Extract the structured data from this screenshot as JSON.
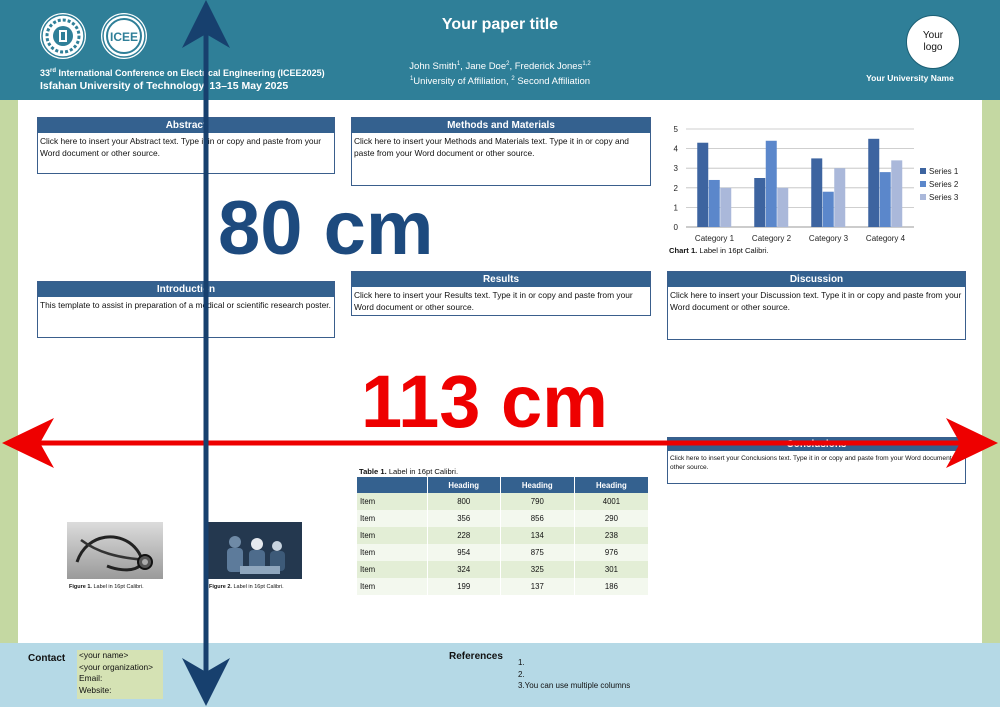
{
  "header": {
    "title": "Your paper title",
    "authors": [
      "John Smith",
      "Jane Doe",
      "Frederick Jones"
    ],
    "author_sups": [
      "1",
      "2",
      "1,2"
    ],
    "affiliation_1_sup": "1",
    "affiliation_1": "University of Affiliation, ",
    "affiliation_2_sup": "2",
    "affiliation_2": " Second Affiliation",
    "conference_line_prefix": "33",
    "conference_line_sup": "rd",
    "conference_line_rest": " International Conference on Electrical Engineering (ICEE2025)",
    "venue_line": "Isfahan University of Technology, 13–15 May 2025",
    "logo_placeholder": "Your logo",
    "university_name": "Your University Name"
  },
  "sections": {
    "abstract": {
      "title": "Abstract",
      "body": "Click here to insert your Abstract text. Type it in or copy and paste from your Word document or other source."
    },
    "methods": {
      "title": "Methods and Materials",
      "body": "Click here to insert your Methods and Materials text. Type it in or copy and paste from your Word document or other source."
    },
    "introduction": {
      "title": "Introduction",
      "body": "This template to assist in preparation of a medical or scientific research poster."
    },
    "results": {
      "title": "Results",
      "body": "Click here to insert your Results text. Type it in or copy and paste from your Word document or other source."
    },
    "discussion": {
      "title": "Discussion",
      "body": "Click here to insert your Discussion text. Type it in or copy and paste from your Word document or other source."
    },
    "conclusions": {
      "title": "Conclusions",
      "body": "Click here to insert your Conclusions text. Type it in or copy and paste from your Word document or other source."
    }
  },
  "chart_caption": {
    "label": "Chart 1.",
    "text": " Label in 16pt Calibri."
  },
  "table_caption": {
    "label": "Table 1.",
    "text": " Label in 16pt Calibri."
  },
  "figure_1_caption": {
    "label": "Figure 1.",
    "text": " Label in 16pt Calibri."
  },
  "figure_2_caption": {
    "label": "Figure 2.",
    "text": " Label in 16pt Calibri."
  },
  "table": {
    "headers": [
      "",
      "Heading",
      "Heading",
      "Heading"
    ],
    "rows": [
      [
        "Item",
        "800",
        "790",
        "4001"
      ],
      [
        "Item",
        "356",
        "856",
        "290"
      ],
      [
        "Item",
        "228",
        "134",
        "238"
      ],
      [
        "Item",
        "954",
        "875",
        "976"
      ],
      [
        "Item",
        "324",
        "325",
        "301"
      ],
      [
        "Item",
        "199",
        "137",
        "186"
      ]
    ]
  },
  "chart_data": {
    "type": "bar",
    "categories": [
      "Category 1",
      "Category 2",
      "Category 3",
      "Category 4"
    ],
    "series": [
      {
        "name": "Series 1",
        "values": [
          4.3,
          2.5,
          3.5,
          4.5
        ]
      },
      {
        "name": "Series 2",
        "values": [
          2.4,
          4.4,
          1.8,
          2.8
        ]
      },
      {
        "name": "Series 3",
        "values": [
          2,
          2,
          3,
          3.4
        ]
      }
    ],
    "ylim": [
      0,
      5
    ],
    "yticks": [
      "0",
      "1",
      "2",
      "3",
      "4",
      "5"
    ],
    "grid": true,
    "legend": "right",
    "colors": [
      "#3d64a0",
      "#5b87cb",
      "#aab8da"
    ]
  },
  "footer": {
    "contact_label": "Contact",
    "contact_lines": [
      "<your name>",
      "<your organization>",
      "Email:",
      "Website:"
    ],
    "references_label": "References",
    "references": [
      "1.",
      "2.",
      "3.You can use multiple columns"
    ]
  },
  "overlay": {
    "height_label": "80 cm",
    "width_label": "113 cm",
    "height_arrow_color": "#17406e",
    "width_arrow_color": "#ee0000"
  },
  "colors": {
    "header_bg": "#2f7f98",
    "section_header": "#34618f",
    "footer_bg": "#b5d9e6",
    "side_strip": "#c4d8a2"
  }
}
